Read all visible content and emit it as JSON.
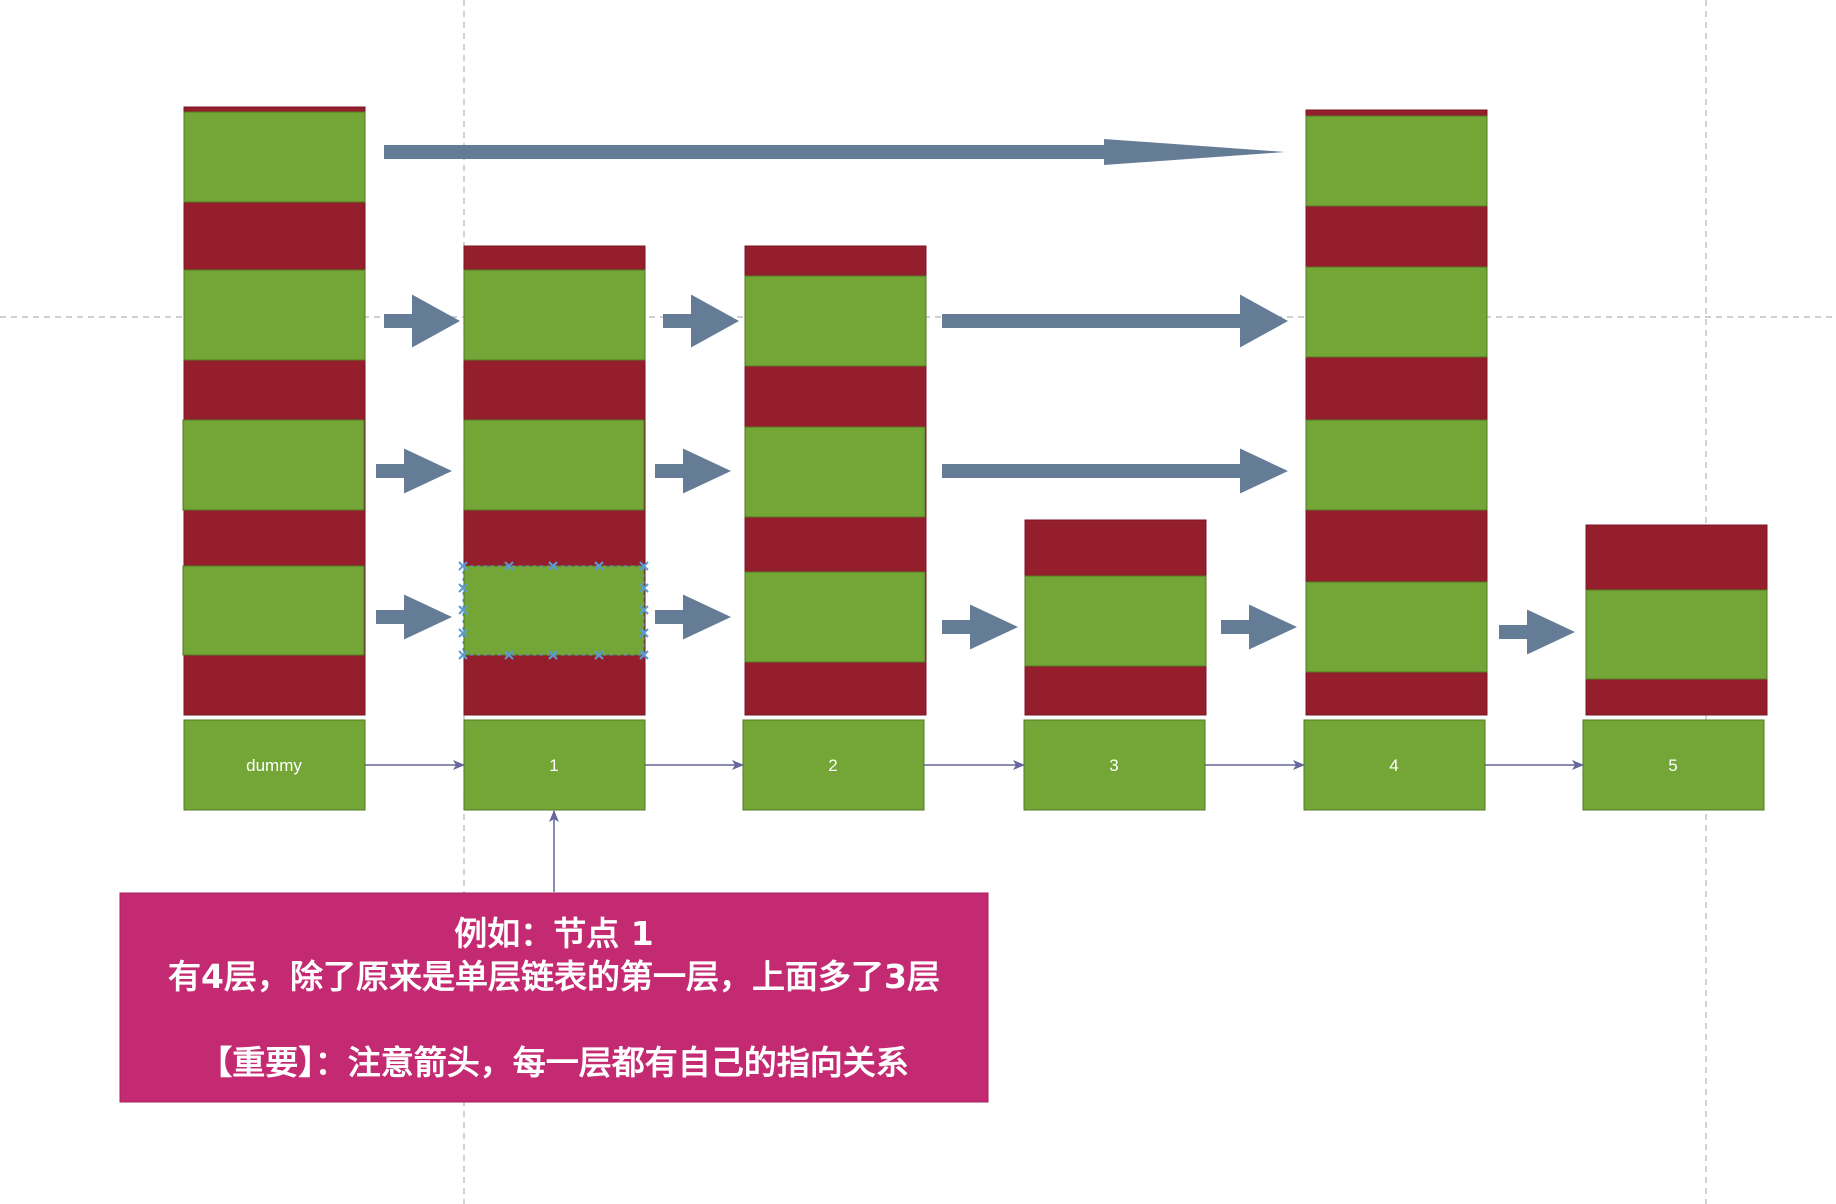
{
  "colors": {
    "background": "#ffffff",
    "level_green": "#73a637",
    "level_green_border": "#4f7a22",
    "level_red": "#951e2d",
    "level_red_border": "#7a1624",
    "pointer_arrow": "#657c97",
    "connector": "#66679a",
    "guide_line": "#b5b5b5",
    "note_fill": "#c42a71",
    "note_border": "#a51f5c",
    "selection_handle": "#5b9bd5",
    "label_text": "#ffffff"
  },
  "nodes": [
    {
      "label": "dummy",
      "levels": 4
    },
    {
      "label": "1",
      "levels": 4,
      "selected_level": 1
    },
    {
      "label": "2",
      "levels": 4
    },
    {
      "label": "3",
      "levels": 1
    },
    {
      "label": "4",
      "levels": 4
    },
    {
      "label": "5",
      "levels": 1
    }
  ],
  "level_pointers": [
    {
      "level": 4,
      "from": "dummy",
      "to": "4"
    },
    {
      "level": 3,
      "from": "dummy",
      "to": "1"
    },
    {
      "level": 3,
      "from": "1",
      "to": "2"
    },
    {
      "level": 3,
      "from": "2",
      "to": "4"
    },
    {
      "level": 2,
      "from": "dummy",
      "to": "1"
    },
    {
      "level": 2,
      "from": "1",
      "to": "2"
    },
    {
      "level": 2,
      "from": "2",
      "to": "4"
    },
    {
      "level": 1,
      "from": "dummy",
      "to": "1"
    },
    {
      "level": 1,
      "from": "1",
      "to": "2"
    },
    {
      "level": 1,
      "from": "2",
      "to": "3"
    },
    {
      "level": 1,
      "from": "3",
      "to": "4"
    },
    {
      "level": 1,
      "from": "4",
      "to": "5"
    }
  ],
  "base_links": [
    {
      "from": "dummy",
      "to": "1"
    },
    {
      "from": "1",
      "to": "2"
    },
    {
      "from": "2",
      "to": "3"
    },
    {
      "from": "3",
      "to": "4"
    },
    {
      "from": "4",
      "to": "5"
    }
  ],
  "note": {
    "points_to": "1",
    "line1": "例如：节点 1",
    "line2": "有4层，除了原来是单层链表的第一层，上面多了3层",
    "line3": "【重要】：注意箭头，每一层都有自己的指向关系"
  }
}
